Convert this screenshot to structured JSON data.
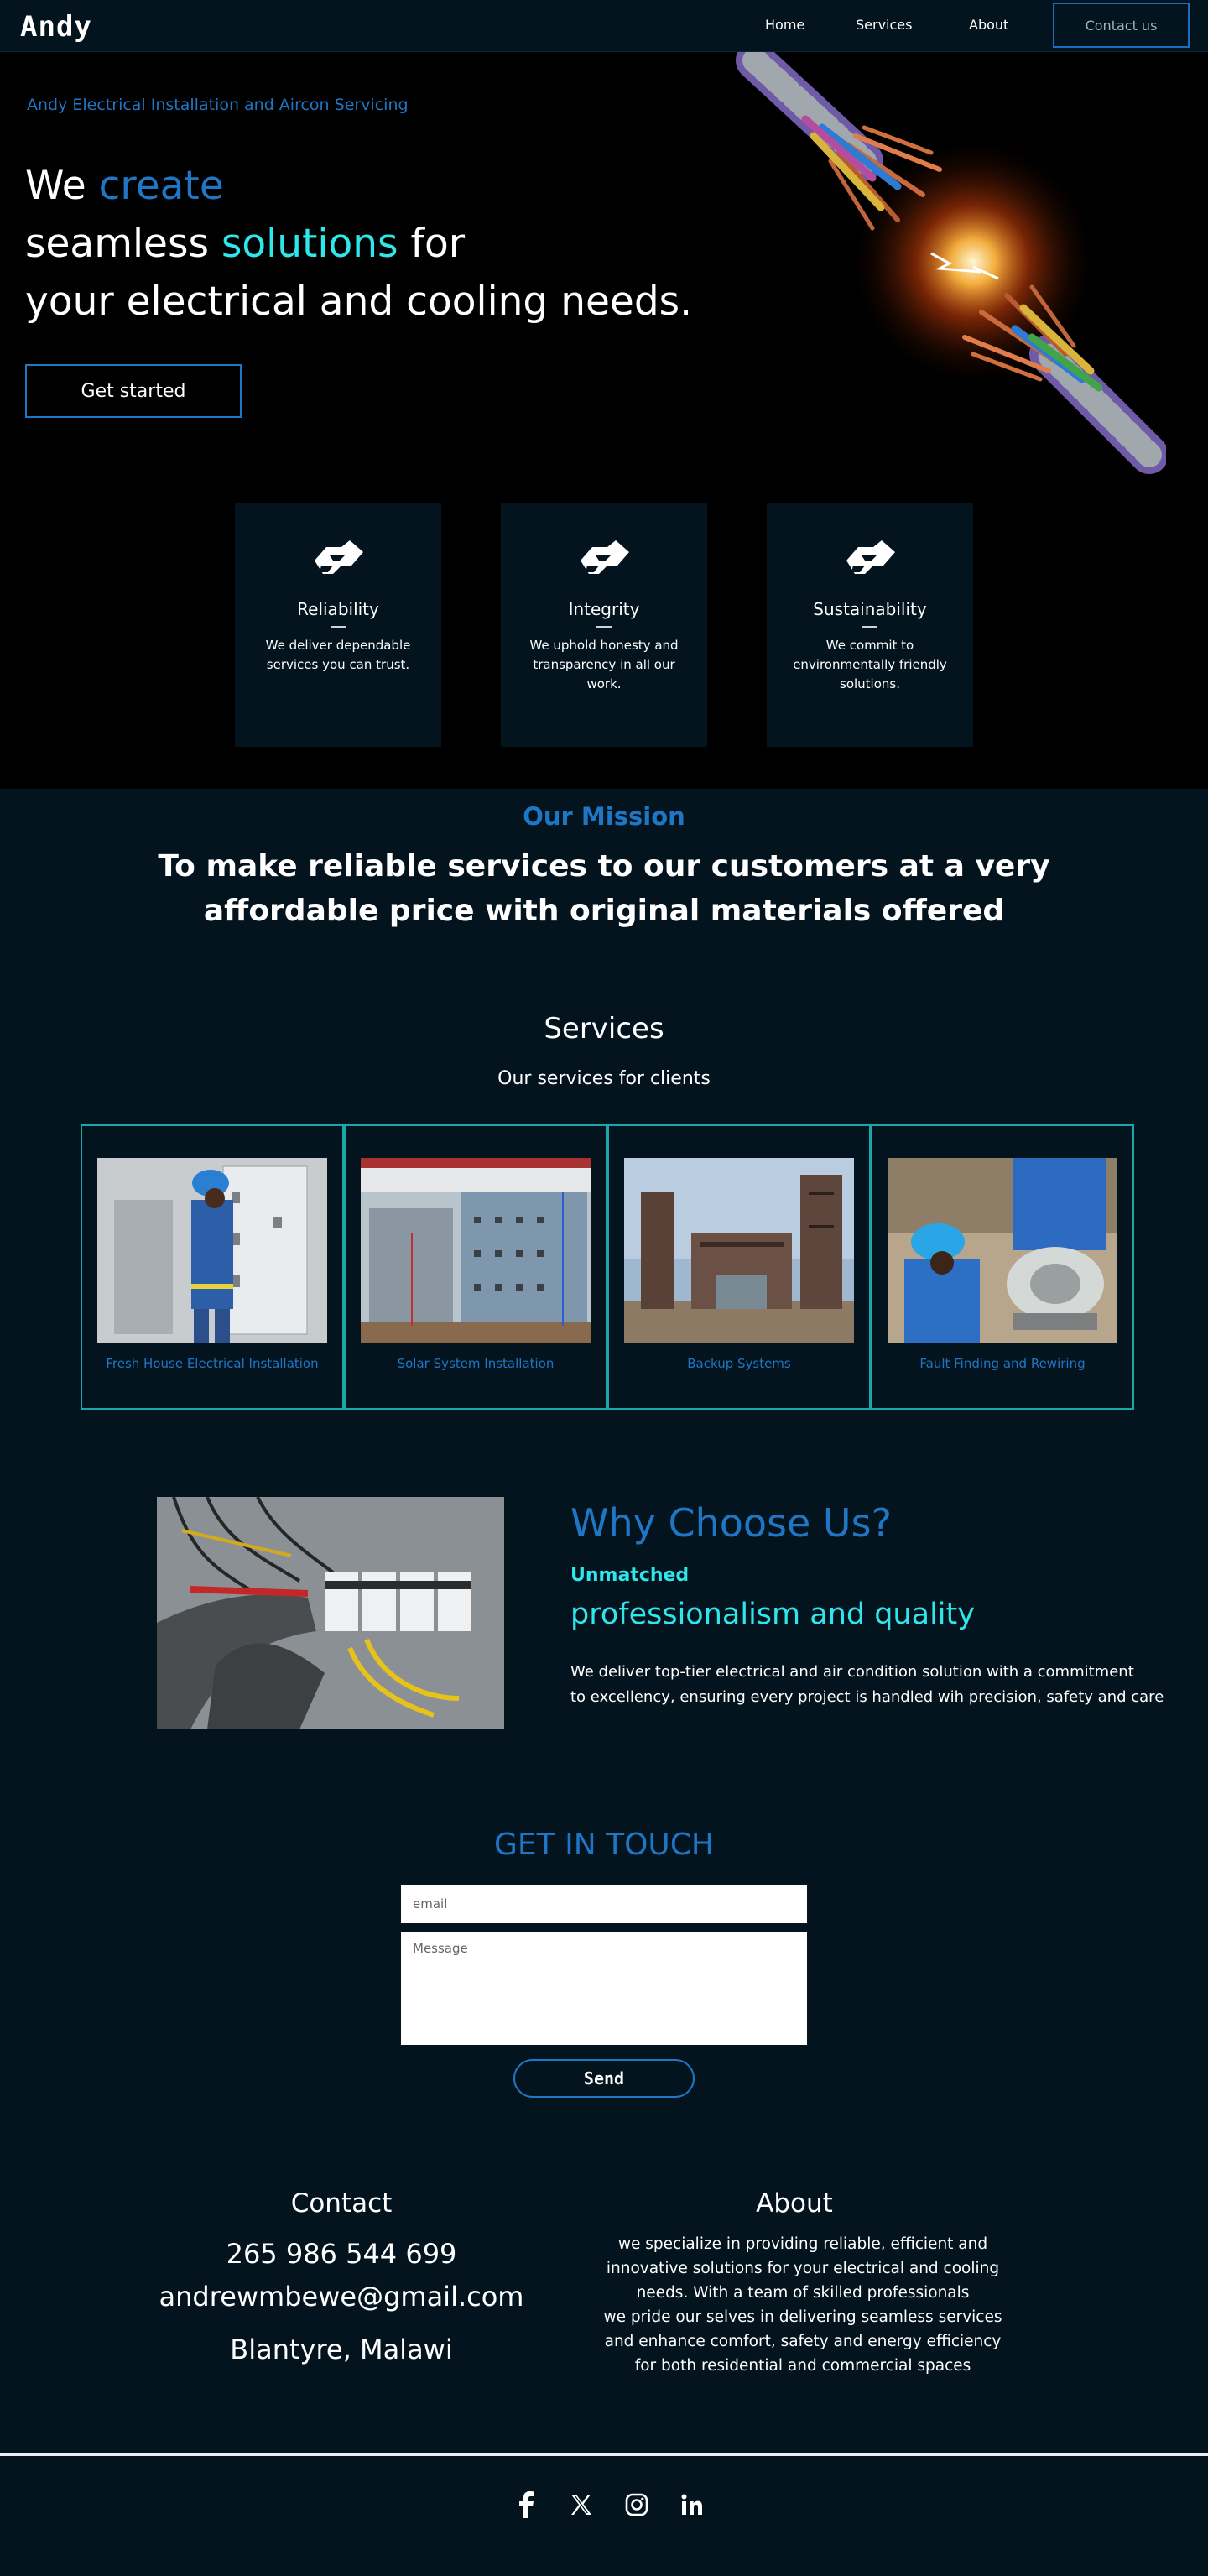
{
  "nav": {
    "logo": "Andy",
    "links": [
      "Home",
      "Services",
      "About"
    ],
    "cta": "Contact us"
  },
  "hero": {
    "tagline": "Andy Electrical Installation and Aircon Servicing",
    "title_line1_a": "We ",
    "title_line1_b": "create",
    "title_line2_a": "seamless ",
    "title_line2_b": "solutions",
    "title_line2_c": " for",
    "title_line3": "your electrical and cooling needs.",
    "button": "Get started"
  },
  "values": [
    {
      "title": "Reliability",
      "desc": "We deliver dependable services you can trust.",
      "icon": "handshake-icon"
    },
    {
      "title": "Integrity",
      "desc": "We uphold honesty and transparency in all our work.",
      "icon": "handshake-icon"
    },
    {
      "title": "Sustainability",
      "desc": "We commit to environmentally friendly solutions.",
      "icon": "handshake-icon"
    }
  ],
  "mission": {
    "heading": "Our Mission",
    "text": "To make reliable services to our customers at a very affordable price with original materials offered"
  },
  "services": {
    "heading": "Services",
    "subheading": "Our services for clients",
    "items": [
      {
        "label": "Fresh House Electrical Installation"
      },
      {
        "label": "Solar System Installation"
      },
      {
        "label": "Backup Systems"
      },
      {
        "label": "Fault Finding and Rewiring"
      }
    ]
  },
  "why": {
    "heading": "Why Choose Us?",
    "sub1": "Unmatched",
    "sub2": "professionalism and quality",
    "desc_line1": "We deliver top-tier electrical and air condition solution with a commitment",
    "desc_line2": "to excellency, ensuring every project is handled wih precision, safety and care"
  },
  "contact_form": {
    "heading": "GET IN TOUCH",
    "email_placeholder": "email",
    "message_placeholder": "Message",
    "send": "Send"
  },
  "contact": {
    "heading": "Contact",
    "phone": "265 986 544 699",
    "email": "andrewmbewe@gmail.com",
    "location": "Blantyre, Malawi"
  },
  "about": {
    "heading": "About",
    "lines": [
      "we specialize in providing reliable, efficient and",
      "innovative solutions for your electrical and cooling",
      "needs. With a team of skilled professionals",
      "we pride our selves in delivering seamless services",
      "and enhance comfort, safety and energy efficiency",
      "for both residential and commercial  spaces"
    ]
  },
  "social": [
    "facebook-icon",
    "x-icon",
    "instagram-icon",
    "linkedin-icon"
  ],
  "colors": {
    "background": "#03141f",
    "hero_background": "#000000",
    "accent_blue": "#1f76c4",
    "accent_cyan": "#2fe6ea",
    "card_border": "#1aa7a8"
  }
}
